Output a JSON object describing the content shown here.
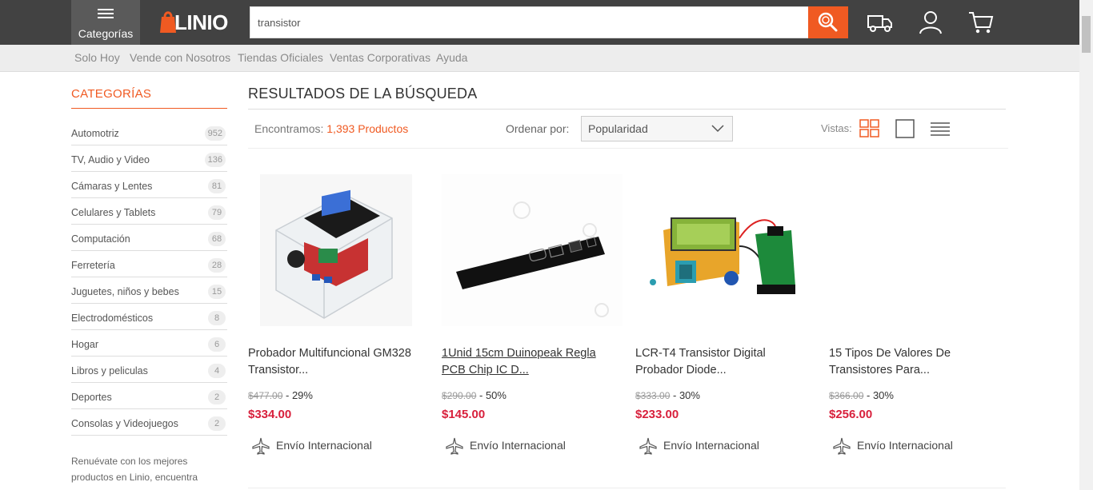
{
  "header": {
    "menu_label": "Categorías",
    "logo_text": "LINIO",
    "search_value": "transistor",
    "brand_color": "#f05a22"
  },
  "subnav": [
    "Solo Hoy",
    "Vende con Nosotros",
    "Tiendas Oficiales",
    "Ventas Corporativas",
    "Ayuda"
  ],
  "sidebar": {
    "title": "CATEGORÍAS",
    "items": [
      {
        "label": "Automotriz",
        "count": "952"
      },
      {
        "label": "TV, Audio y Video",
        "count": "136"
      },
      {
        "label": "Cámaras y Lentes",
        "count": "81"
      },
      {
        "label": "Celulares y Tablets",
        "count": "79"
      },
      {
        "label": "Computación",
        "count": "68"
      },
      {
        "label": "Ferretería",
        "count": "28"
      },
      {
        "label": "Juguetes, niños y bebes",
        "count": "15"
      },
      {
        "label": "Electrodomésticos",
        "count": "8"
      },
      {
        "label": "Hogar",
        "count": "6"
      },
      {
        "label": "Libros y peliculas",
        "count": "4"
      },
      {
        "label": "Deportes",
        "count": "2"
      },
      {
        "label": "Consolas y Videojuegos",
        "count": "2"
      }
    ],
    "promo_lines": [
      "Renuévate con los mejores",
      "productos en Linio, encuentra"
    ]
  },
  "results": {
    "title": "RESULTADOS DE LA BÚSQUEDA",
    "found_prefix": "Encontramos:",
    "found_count": "1,393 Productos",
    "order_label": "Ordenar por:",
    "order_value": "Popularidad",
    "views_label": "Vistas:"
  },
  "products": [
    {
      "title": "Probador Multifuncional GM328 Transistor...",
      "old_price": "$477.00",
      "discount": " - 29%",
      "price": "$334.00",
      "shipping": "Envío Internacional",
      "image": "transistor-tester-acrylic-case"
    },
    {
      "title": "1Unid 15cm Duinopeak Regla PCB Chip IC D...",
      "old_price": "$290.00",
      "discount": " - 50%",
      "price": "$145.00",
      "shipping": "Envío Internacional",
      "image": "black-pcb-ruler"
    },
    {
      "title": "LCR-T4 Transistor Digital Probador Diode...",
      "old_price": "$333.00",
      "discount": " - 30%",
      "price": "$233.00",
      "shipping": "Envío Internacional",
      "image": "lcr-t4-tester-with-battery"
    },
    {
      "title": "15 Tipos De Valores De Transistores Para...",
      "old_price": "$366.00",
      "discount": " - 30%",
      "price": "$256.00",
      "shipping": "Envío Internacional",
      "image": "blank-image"
    }
  ]
}
